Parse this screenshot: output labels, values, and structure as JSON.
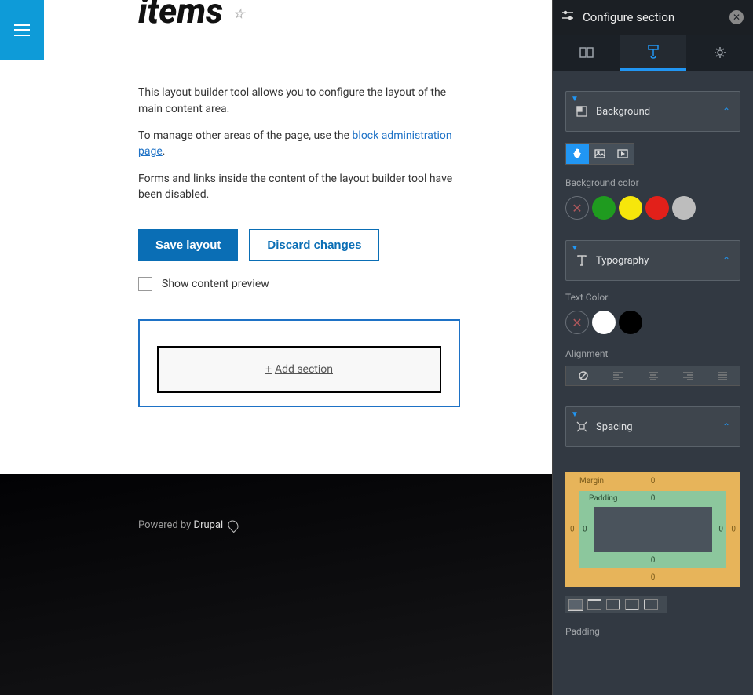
{
  "title": "items",
  "intro": {
    "p1": "This layout builder tool allows you to configure the layout of the main content area.",
    "p2_prefix": "To manage other areas of the page, use the ",
    "p2_link": "block administration page",
    "p2_suffix": ".",
    "p3": "Forms and links inside the content of the layout builder tool have been disabled."
  },
  "buttons": {
    "save": "Save layout",
    "discard": "Discard changes"
  },
  "show_preview": "Show content preview",
  "add_section": "Add section",
  "footer": {
    "prefix": "Powered by ",
    "link": "Drupal"
  },
  "panel": {
    "title": "Configure section",
    "sections": {
      "background": {
        "title": "Background",
        "bg_color_label": "Background color",
        "swatches": [
          "none",
          "#1f9b1f",
          "#f6e60b",
          "#e2201a",
          "#bdbdbd"
        ]
      },
      "typography": {
        "title": "Typography",
        "text_color_label": "Text Color",
        "swatches": [
          "none",
          "#ffffff",
          "#000000"
        ],
        "alignment_label": "Alignment",
        "align_options": [
          "none",
          "left",
          "center",
          "right",
          "justify"
        ]
      },
      "spacing": {
        "title": "Spacing",
        "margin_label": "Margin",
        "padding_label": "Padding",
        "margin": {
          "top": "0",
          "right": "0",
          "bottom": "0",
          "left": "0"
        },
        "padding": {
          "top": "0",
          "right": "0",
          "bottom": "0",
          "left": "0"
        },
        "padding_section_label": "Padding"
      }
    }
  }
}
